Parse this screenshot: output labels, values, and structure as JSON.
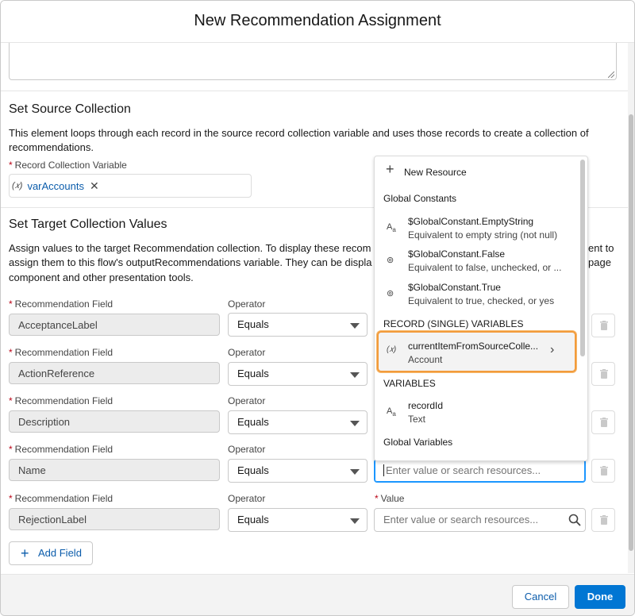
{
  "dialog": {
    "title": "New Recommendation Assignment"
  },
  "source": {
    "title": "Set Source Collection",
    "description": "This element loops through each record in the source record collection variable and uses those records to create a collection of recommendations.",
    "field_label": "Record Collection Variable",
    "pill_value": "varAccounts"
  },
  "target": {
    "title": "Set Target Collection Values",
    "description_line1": "Assign values to the target Recommendation collection. To display these recom",
    "description_line1_end": "ent to",
    "description_line2": "assign them to this flow's outputRecommendations variable. They can be displa",
    "description_line2_end": "page",
    "description_line3": "component and other presentation tools."
  },
  "rows": [
    {
      "field_label": "Recommendation Field",
      "field": "AcceptanceLabel",
      "operator_label": "Operator",
      "operator": "Equals"
    },
    {
      "field_label": "Recommendation Field",
      "field": "ActionReference",
      "operator_label": "Operator",
      "operator": "Equals"
    },
    {
      "field_label": "Recommendation Field",
      "field": "Description",
      "operator_label": "Operator",
      "operator": "Equals"
    },
    {
      "field_label": "Recommendation Field",
      "field": "Name",
      "operator_label": "Operator",
      "operator": "Equals",
      "value_placeholder": "Enter value or search resources..."
    },
    {
      "field_label": "Recommendation Field",
      "field": "RejectionLabel",
      "operator_label": "Operator",
      "operator": "Equals",
      "value_label": "Value",
      "value_placeholder": "Enter value or search resources..."
    }
  ],
  "add_field_label": "Add Field",
  "dropdown": {
    "new_resource": "New Resource",
    "global_constants_heading": "Global Constants",
    "items": [
      {
        "title": "$GlobalConstant.EmptyString",
        "sub": "Equivalent to empty string (not null)",
        "icon": "text-icon"
      },
      {
        "title": "$GlobalConstant.False",
        "sub": "Equivalent to false, unchecked, or ...",
        "icon": "boolean-icon"
      },
      {
        "title": "$GlobalConstant.True",
        "sub": "Equivalent to true, checked, or yes",
        "icon": "boolean-icon"
      }
    ],
    "record_heading": "RECORD (SINGLE) VARIABLES",
    "record_item": {
      "title": "currentItemFromSourceColle...",
      "sub": "Account"
    },
    "variables_heading": "VARIABLES",
    "variable_item": {
      "title": "recordId",
      "sub": "Text"
    },
    "global_variables_heading": "Global Variables"
  },
  "footer": {
    "cancel": "Cancel",
    "done": "Done"
  },
  "colors": {
    "brand": "#0176d3",
    "highlight": "#f29b3b",
    "required": "#ba0517"
  }
}
